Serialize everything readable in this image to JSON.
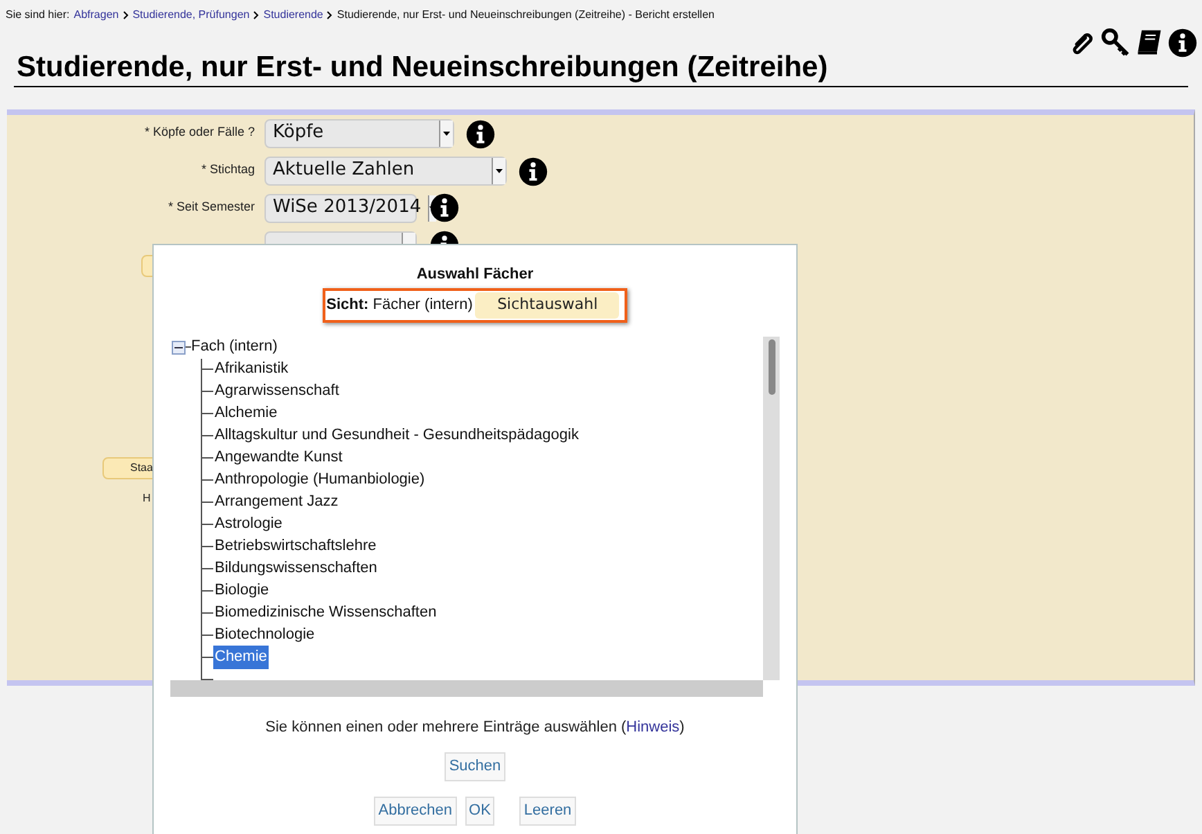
{
  "breadcrumb": {
    "prefix": "Sie sind hier:",
    "links": [
      "Abfragen",
      "Studierende, Prüfungen",
      "Studierende"
    ],
    "current": "Studierende, nur Erst- und Neueinschreibungen (Zeitreihe) - Bericht erstellen"
  },
  "page_title": "Studierende, nur Erst- und Neueinschreibungen (Zeitreihe)",
  "form": {
    "fields": [
      {
        "label": "* Köpfe oder Fälle ?",
        "value": "Köpfe"
      },
      {
        "label": "* Stichtag",
        "value": "Aktuelle Zahlen"
      },
      {
        "label": "* Seit Semester",
        "value": "WiSe 2013/2014"
      }
    ],
    "button": "Staa",
    "label_partial": "H"
  },
  "dialog": {
    "title": "Auswahl Fächer",
    "view_label": "Sicht:",
    "view_value": "Fächer (intern)",
    "view_button": "Sichtauswahl",
    "tree": {
      "label": "Fach (intern)",
      "expanded": true,
      "children": [
        {
          "label": "Afrikanistik",
          "selected": false
        },
        {
          "label": "Agrarwissenschaft",
          "selected": false
        },
        {
          "label": "Alchemie",
          "selected": false
        },
        {
          "label": "Alltagskultur und Gesundheit - Gesundheitspädagogik",
          "selected": false
        },
        {
          "label": "Angewandte Kunst",
          "selected": false
        },
        {
          "label": "Anthropologie (Humanbiologie)",
          "selected": false
        },
        {
          "label": "Arrangement Jazz",
          "selected": false
        },
        {
          "label": "Astrologie",
          "selected": false
        },
        {
          "label": "Betriebswirtschaftslehre",
          "selected": false
        },
        {
          "label": "Bildungswissenschaften",
          "selected": false
        },
        {
          "label": "Biologie",
          "selected": false
        },
        {
          "label": "Biomedizinische Wissenschaften",
          "selected": false
        },
        {
          "label": "Biotechnologie",
          "selected": false
        },
        {
          "label": "Chemie",
          "selected": true
        }
      ]
    },
    "hint_text": "Sie können einen oder mehrere Einträge auswählen (",
    "hint_link": "Hinweis",
    "hint_end": ")",
    "search_button": "Suchen",
    "buttons": [
      "Abbrechen",
      "OK",
      "Leeren"
    ]
  }
}
